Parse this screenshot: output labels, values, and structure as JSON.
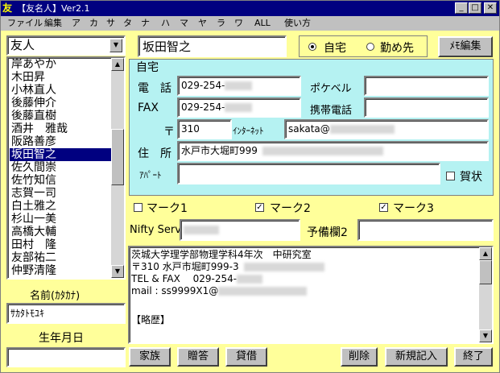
{
  "window": {
    "app_icon": "友",
    "title": "【友名人】Ver2.1",
    "min_glyph": "_",
    "max_glyph": "□",
    "close_glyph": "✕"
  },
  "menu": [
    "ファイル",
    "編集",
    "ア",
    "カ",
    "サ",
    "タ",
    "ナ",
    "ハ",
    "マ",
    "ヤ",
    "ラ",
    "ワ",
    "ALL",
    "使い方"
  ],
  "group_select": {
    "value": "友人"
  },
  "name_field": {
    "value": "坂田智之"
  },
  "address_type": {
    "home": "自宅",
    "work": "勤め先",
    "selected": "home"
  },
  "memo_edit_button": "ﾒﾓ編集",
  "contacts": [
    "岸あやか",
    "木田昇",
    "小林直人",
    "後藤伸介",
    "後藤直樹",
    "酒井　雅哉",
    "阪路善彦",
    "坂田智之",
    "佐久間崇",
    "佐竹知信",
    "志賀一司",
    "白土雅之",
    "杉山一美",
    "高橋大輔",
    "田村　隆",
    "友部祐二",
    "仲野清隆"
  ],
  "selected_contact_index": 7,
  "home_panel": {
    "legend": "自宅",
    "phone_label": "電　話",
    "phone_value": "029-254-",
    "pager_label": "ポケベル",
    "pager_value": "",
    "fax_label": "FAX",
    "fax_value": "029-254-",
    "mobile_label": "携帯電話",
    "mobile_value": "",
    "postal_label": "〒",
    "postal_value": "310",
    "internet_label": "ｲﾝﾀｰﾈｯﾄ",
    "internet_value": "sakata@",
    "address_label": "住　所",
    "address_value": "水戸市大堀町999",
    "apartment_label": "ｱﾊﾟｰﾄ",
    "apartment_value": "",
    "greeting_label": "賀状"
  },
  "marks": [
    {
      "label": "マーク1",
      "checked": false,
      "glyph": ""
    },
    {
      "label": "マーク2",
      "checked": true,
      "glyph": "✓"
    },
    {
      "label": "マーク3",
      "checked": true,
      "glyph": "✓"
    }
  ],
  "nifty_label": "Nifty Serv",
  "nifty_value": "",
  "reserve_label": "予備欄2",
  "reserve_value": "",
  "memo_lines": [
    "茨城大学理学部物理学科4年次　中研究室",
    "〒310 水戸市堀町999-3",
    "TEL & FAX　 029-254-",
    "mail : ss9999X1@",
    "",
    "【略歴】"
  ],
  "kana_name_label": "名前(ｶﾀｶﾅ)",
  "kana_name_value": "ｻｶﾀﾄﾓﾕｷ",
  "birthday_label": "生年月日",
  "birthday_value": "",
  "buttons": {
    "family": "家族",
    "gifts": "贈答",
    "loans": "貸借",
    "delete": "削除",
    "new_entry": "新規記入",
    "exit": "終了"
  },
  "scroll": {
    "up": "▲",
    "down": "▼",
    "dropdown": "▼"
  }
}
